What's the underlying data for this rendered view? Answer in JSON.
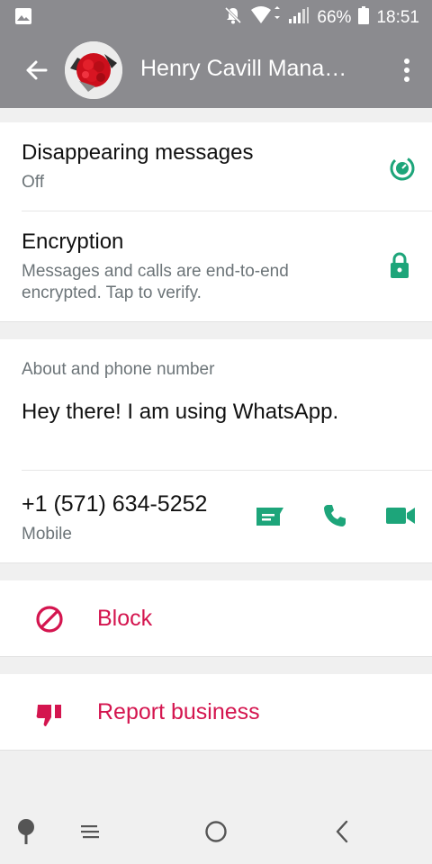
{
  "status_bar": {
    "battery_percent": "66%",
    "time": "18:51"
  },
  "header": {
    "contact_name": "Henry Cavill Mana…"
  },
  "settings": {
    "disappearing_title": "Disappearing messages",
    "disappearing_value": "Off",
    "encryption_title": "Encryption",
    "encryption_desc_line1": "Messages and calls are end-to-end",
    "encryption_desc_line2": "encrypted. Tap to verify."
  },
  "about": {
    "section_label": "About and phone number",
    "status_text": "Hey there! I am using WhatsApp.",
    "phone_number": "+1 (571) 634-5252",
    "phone_type": "Mobile"
  },
  "actions": {
    "block_label": "Block",
    "report_label": "Report business"
  },
  "colors": {
    "accent": "#1da57a",
    "danger": "#d4154f",
    "header_bg": "#8b8b8f"
  }
}
